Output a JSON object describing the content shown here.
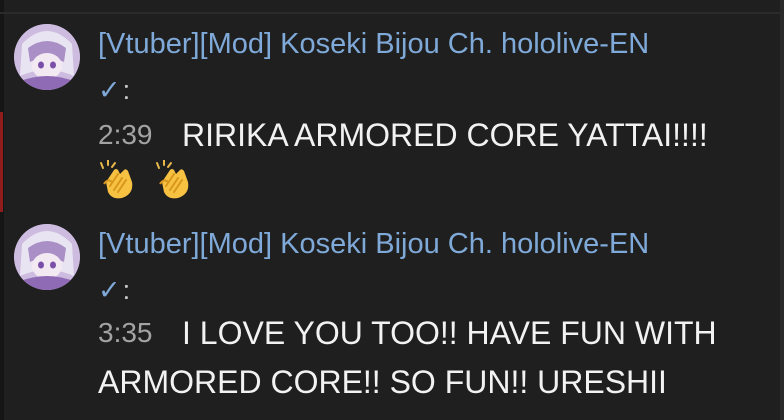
{
  "messages": [
    {
      "author": "[Vtuber][Mod] Koseki Bijou Ch. hololive-EN",
      "badge_icon": "verified-check-icon",
      "check": "✓",
      "colon": ":",
      "time": "2:39",
      "text_lines": [
        "RIRIKA ARMORED CORE YATTAI!!!!"
      ],
      "emoji": [
        "clapping-hands-icon",
        "clapping-hands-icon"
      ]
    },
    {
      "author": "[Vtuber][Mod] Koseki Bijou Ch. hololive-EN",
      "badge_icon": "verified-check-icon",
      "check": "✓",
      "colon": ":",
      "time": "3:35",
      "text_lines": [
        "I LOVE YOU TOO!! HAVE FUN WITH",
        "ARMORED CORE!! SO FUN!! URESHII"
      ]
    }
  ],
  "colors": {
    "background": "#1f1f1f",
    "author": "#7fa9d8",
    "timestamp": "#a3a3a3",
    "message": "#f2f2f2"
  }
}
